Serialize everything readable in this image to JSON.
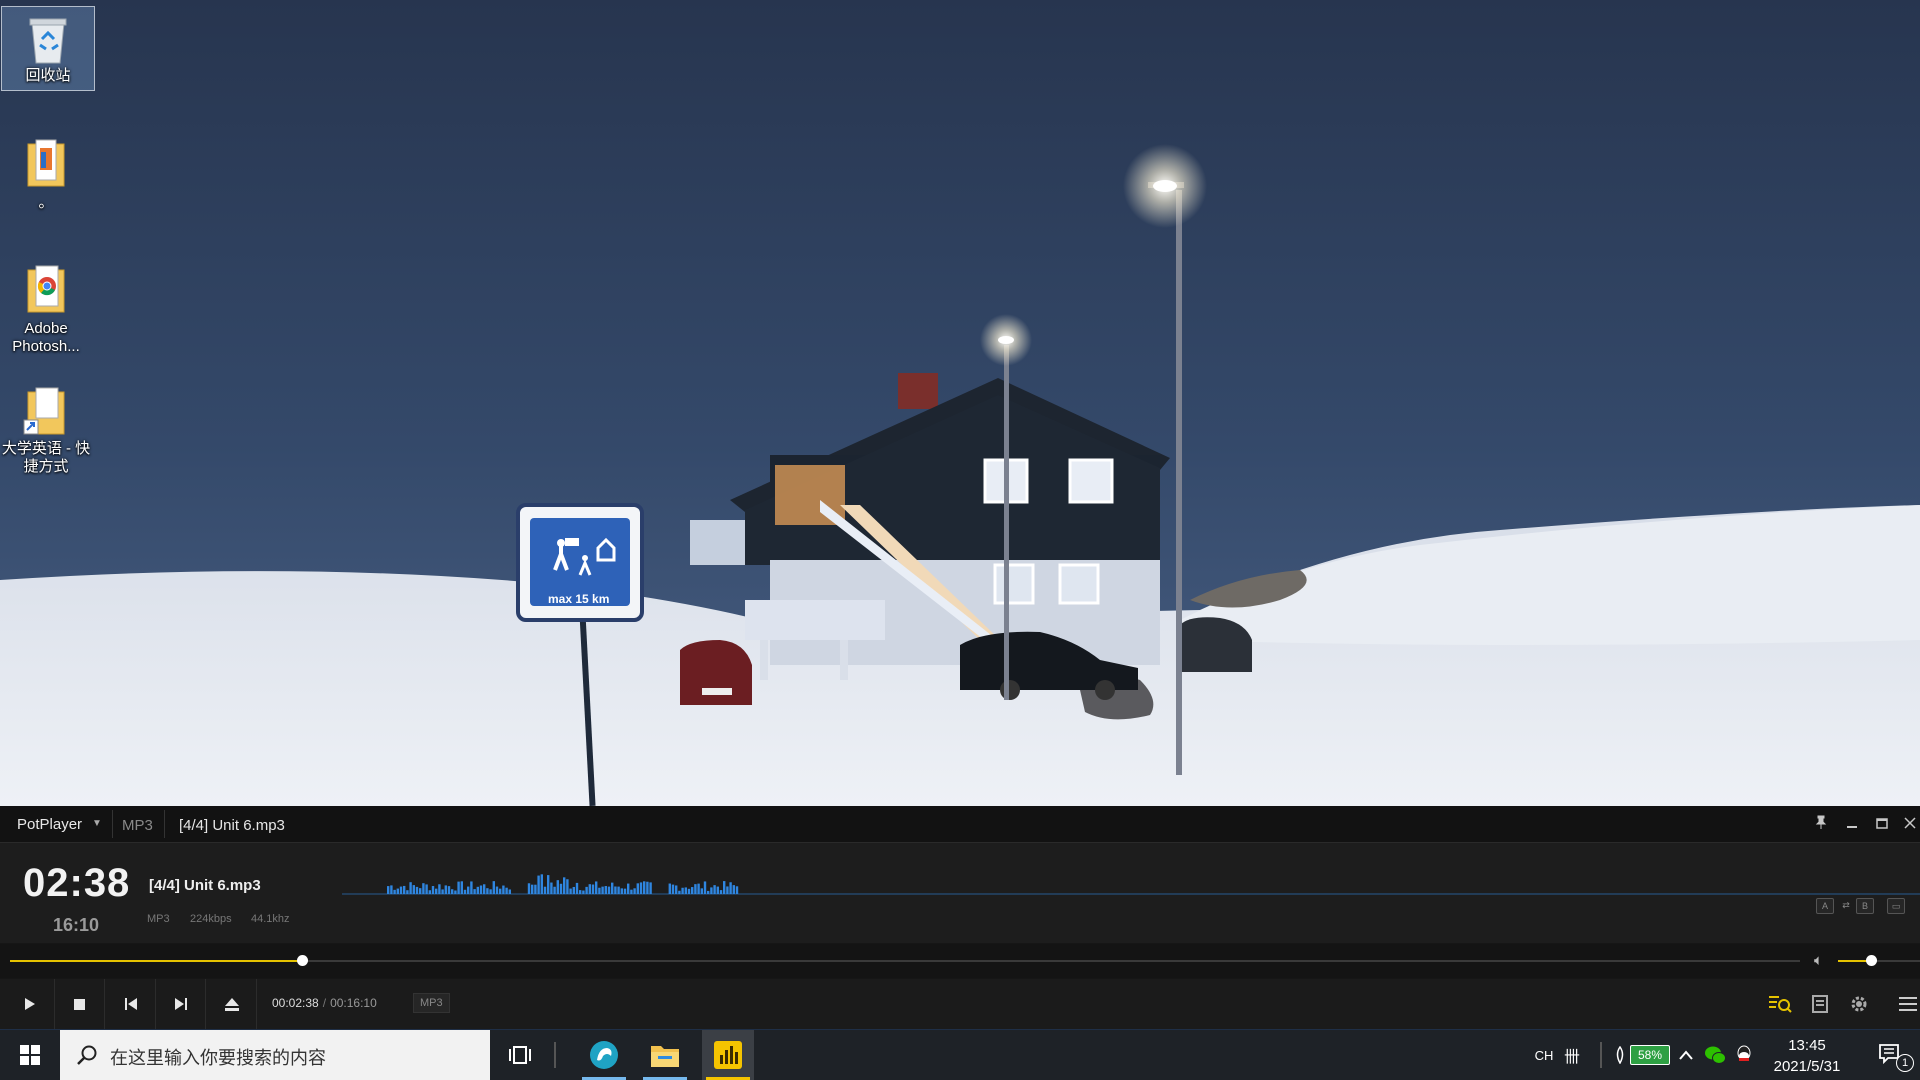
{
  "desktop": {
    "icons": [
      {
        "label": "回收站",
        "icon": "recycle-bin-icon"
      },
      {
        "label": "。",
        "icon": "folder-shortcut-icon"
      },
      {
        "label": "Adobe Photosh...",
        "icon": "chrome-folder-icon"
      },
      {
        "label": "大学英语 - 快捷方式",
        "icon": "folder-shortcut-icon"
      }
    ],
    "sign_text": "max 15 km"
  },
  "player": {
    "app_name": "PotPlayer",
    "format": "MP3",
    "title": "[4/4] Unit 6.mp3",
    "current_time": "02:38",
    "total_time": "16:10",
    "info_title": "[4/4] Unit 6.mp3",
    "codec": "MP3",
    "bitrate": "224kbps",
    "sample_rate": "44.1khz",
    "time_full_current": "00:02:38",
    "time_full_total": "00:16:10",
    "badge": "MP3",
    "progress_fraction": 0.163,
    "volume_fraction": 0.4,
    "mini_buttons": [
      "A",
      "B"
    ],
    "accent_color": "#e6c300",
    "spectrum_color": "#2f86e0"
  },
  "taskbar": {
    "search_placeholder": "在这里输入你要搜索的内容",
    "input_method": "CH",
    "ime_grid": "卌",
    "battery": "58%",
    "time": "13:45",
    "date": "2021/5/31",
    "notification_count": "1",
    "apps": [
      "browser-icon",
      "file-explorer-icon",
      "potplayer-icon"
    ]
  }
}
